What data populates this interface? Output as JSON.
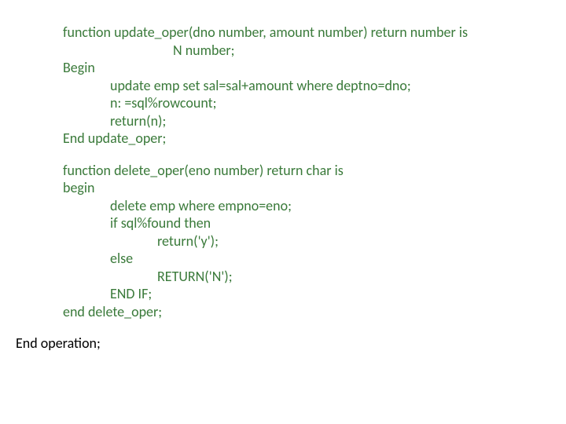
{
  "code": {
    "func_update": {
      "sig": "function update_oper(dno number, amount number) return number is",
      "decl": "N number;",
      "begin": "Begin",
      "l1": "update emp set sal=sal+amount where deptno=dno;",
      "l2": "n: =sql%rowcount;",
      "l3": "return(n);",
      "end": "End update_oper;"
    },
    "func_delete": {
      "sig": "function delete_oper(eno number) return char is",
      "begin": "begin",
      "l1": "delete emp where empno=eno;",
      "l2": "if sql%found then",
      "l3": "return('y');",
      "l4": "else",
      "l5": "RETURN('N');",
      "l6": "END IF;",
      "end": "end delete_oper;"
    },
    "pkg_end": "End operation;"
  }
}
